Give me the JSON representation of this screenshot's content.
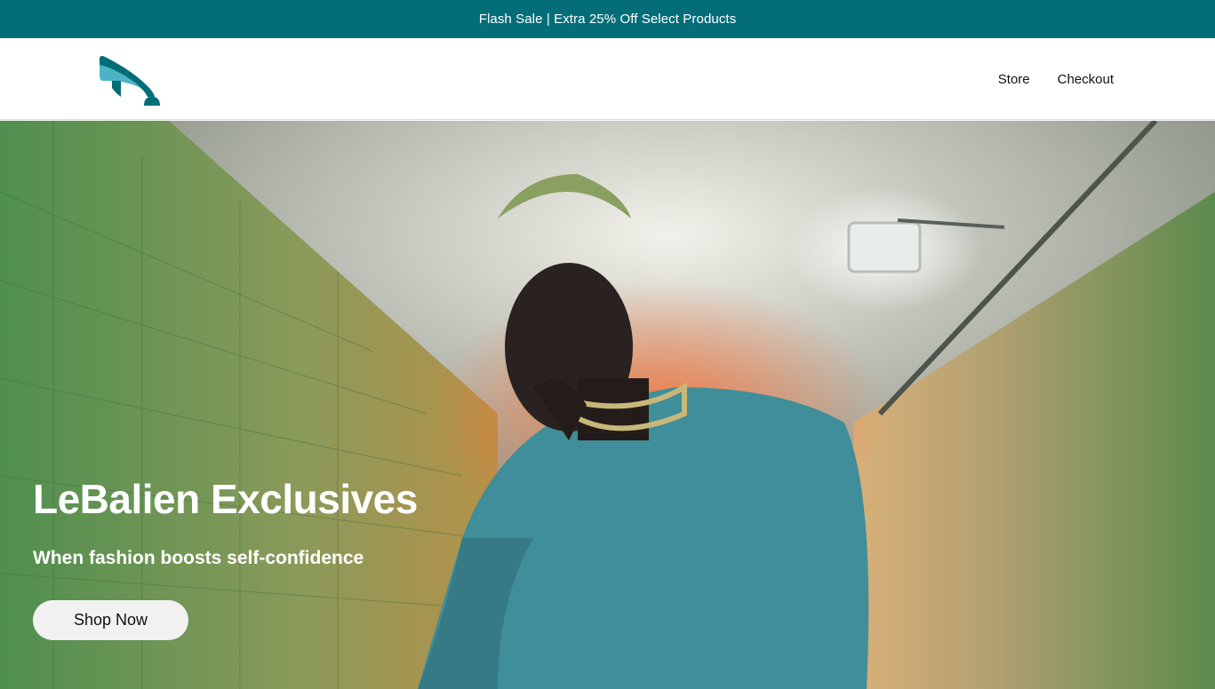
{
  "promo": {
    "text": "Flash Sale | Extra 25% Off Select Products"
  },
  "header": {
    "logo_icon": "whale-tail-logo",
    "nav": [
      {
        "label": "Store"
      },
      {
        "label": "Checkout"
      }
    ]
  },
  "hero": {
    "title": "LeBalien Exclusives",
    "subtitle": "When fashion boosts self-confidence",
    "cta_label": "Shop Now",
    "image_subject": "model in teal sweatshirt with gold chain in a tiled tunnel"
  },
  "colors": {
    "brand_teal": "#046e78",
    "logo_light": "#4bb4c6",
    "button_bg": "#f1f1f1"
  }
}
